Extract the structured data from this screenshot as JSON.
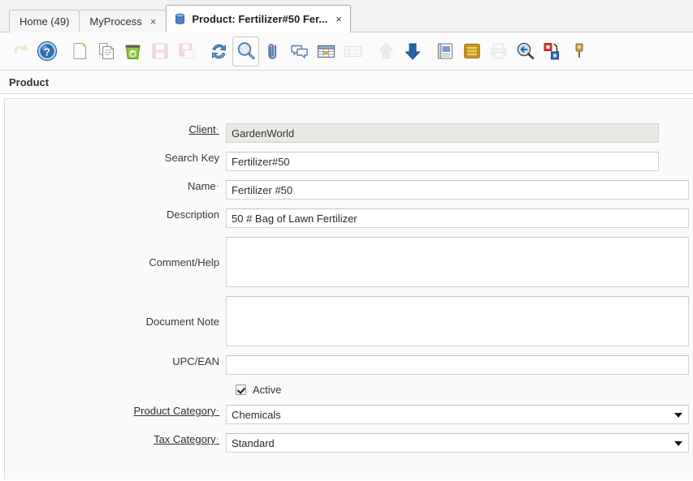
{
  "tabs": [
    {
      "label": "Home (49)",
      "icon": "",
      "closable": false,
      "active": false
    },
    {
      "label": "MyProcess",
      "icon": "",
      "closable": true,
      "active": false
    },
    {
      "label": "Product: Fertilizer#50 Fer...",
      "icon": "database-icon",
      "closable": true,
      "active": true
    }
  ],
  "tab_close_glyph": "×",
  "toolbar": {
    "buttons": [
      {
        "name": "undo-icon",
        "label": "Undo",
        "state": "disabled"
      },
      {
        "name": "help-icon",
        "label": "Help",
        "state": "enabled"
      },
      {
        "name": "new-record-icon",
        "label": "New Record",
        "state": "enabled"
      },
      {
        "name": "copy-record-icon",
        "label": "Copy Record",
        "state": "enabled"
      },
      {
        "name": "delete-icon",
        "label": "Delete",
        "state": "enabled"
      },
      {
        "name": "save-icon",
        "label": "Save Changes",
        "state": "disabled"
      },
      {
        "name": "save-create-icon",
        "label": "Save and Create New",
        "state": "disabled"
      },
      {
        "name": "refresh-icon",
        "label": "Refresh",
        "state": "enabled"
      },
      {
        "name": "find-icon",
        "label": "Find Records",
        "state": "selected"
      },
      {
        "name": "attachment-icon",
        "label": "Attachment",
        "state": "enabled"
      },
      {
        "name": "chat-icon",
        "label": "Chat / Comments",
        "state": "enabled"
      },
      {
        "name": "grid-toggle-icon",
        "label": "Toggle Grid View",
        "state": "enabled"
      },
      {
        "name": "multi-select-icon",
        "label": "Multi Selection",
        "state": "disabled"
      },
      {
        "name": "parent-record-icon",
        "label": "Parent Record",
        "state": "disabled"
      },
      {
        "name": "detail-record-icon",
        "label": "Detail Record",
        "state": "enabled"
      },
      {
        "name": "report-icon",
        "label": "Report",
        "state": "enabled"
      },
      {
        "name": "archive-icon",
        "label": "Archived Documents",
        "state": "enabled"
      },
      {
        "name": "print-icon",
        "label": "Print",
        "state": "disabled"
      },
      {
        "name": "zoom-across-icon",
        "label": "Zoom Across",
        "state": "enabled"
      },
      {
        "name": "export-icon",
        "label": "Export Records",
        "state": "enabled"
      },
      {
        "name": "product-info-icon",
        "label": "Product Info",
        "state": "enabled"
      }
    ]
  },
  "window": {
    "title": "Product"
  },
  "form": {
    "required_marker": "·",
    "fields": [
      {
        "name": "client",
        "label": "Client",
        "value": "GardenWorld",
        "type": "text",
        "required": true,
        "readonly": true,
        "link": true,
        "width": "short"
      },
      {
        "name": "search-key",
        "label": "Search Key",
        "value": "Fertilizer#50",
        "type": "text",
        "required": false,
        "readonly": false,
        "link": false,
        "width": "short"
      },
      {
        "name": "name",
        "label": "Name",
        "value": "Fertilizer #50",
        "type": "text",
        "required": true,
        "readonly": false,
        "link": false,
        "width": "long"
      },
      {
        "name": "description",
        "label": "Description",
        "value": "50 # Bag of Lawn Fertilizer",
        "type": "text",
        "required": false,
        "readonly": false,
        "link": false,
        "width": "long"
      },
      {
        "name": "comment-help",
        "label": "Comment/Help",
        "value": "",
        "type": "textarea",
        "required": false,
        "readonly": false,
        "link": false,
        "width": "long"
      },
      {
        "name": "document-note",
        "label": "Document Note",
        "value": "",
        "type": "textarea",
        "required": false,
        "readonly": false,
        "link": false,
        "width": "long"
      },
      {
        "name": "upc-ean",
        "label": "UPC/EAN",
        "value": "",
        "type": "text",
        "required": false,
        "readonly": false,
        "link": false,
        "width": "long"
      }
    ],
    "active_checkbox": {
      "label": "Active",
      "checked": true
    },
    "selects": [
      {
        "name": "product-category",
        "label": "Product Category",
        "value": "Chemicals",
        "required": true,
        "link": true
      },
      {
        "name": "tax-category",
        "label": "Tax Category",
        "value": "Standard",
        "required": true,
        "link": true
      }
    ]
  },
  "colors": {
    "tabbar_bg": "#f2f2f2",
    "toolbar_bg": "#fbfbfb",
    "panel_bg": "#fafafa",
    "readonly_field_bg": "#e9e9e4",
    "accent_blue": "#2f6fad",
    "delete_green": "#7fb03a"
  }
}
